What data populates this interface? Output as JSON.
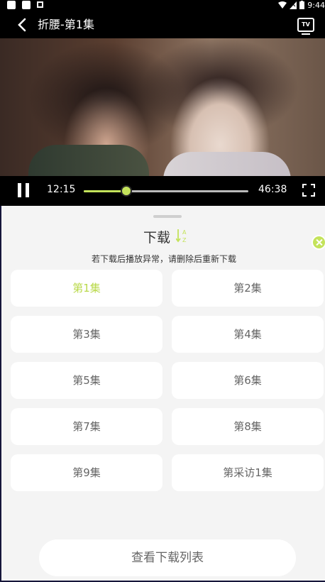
{
  "status_bar": {
    "time": "9:44"
  },
  "header": {
    "title": "折腰-第1集",
    "tv_label": "TV"
  },
  "player": {
    "current_time": "12:15",
    "total_time": "46:38",
    "progress": 0.26,
    "accent": "#c4e35b"
  },
  "sheet": {
    "title": "下载",
    "sort_icon": "sort-az-icon",
    "notice": "若下载后播放异常，请删除后重新下载",
    "episodes": [
      {
        "label": "第1集",
        "active": true
      },
      {
        "label": "第2集",
        "active": false
      },
      {
        "label": "第3集",
        "active": false
      },
      {
        "label": "第4集",
        "active": false
      },
      {
        "label": "第5集",
        "active": false
      },
      {
        "label": "第6集",
        "active": false
      },
      {
        "label": "第7集",
        "active": false
      },
      {
        "label": "第8集",
        "active": false
      },
      {
        "label": "第9集",
        "active": false
      },
      {
        "label": "第采访1集",
        "active": false
      }
    ],
    "view_list_label": "查看下载列表"
  }
}
